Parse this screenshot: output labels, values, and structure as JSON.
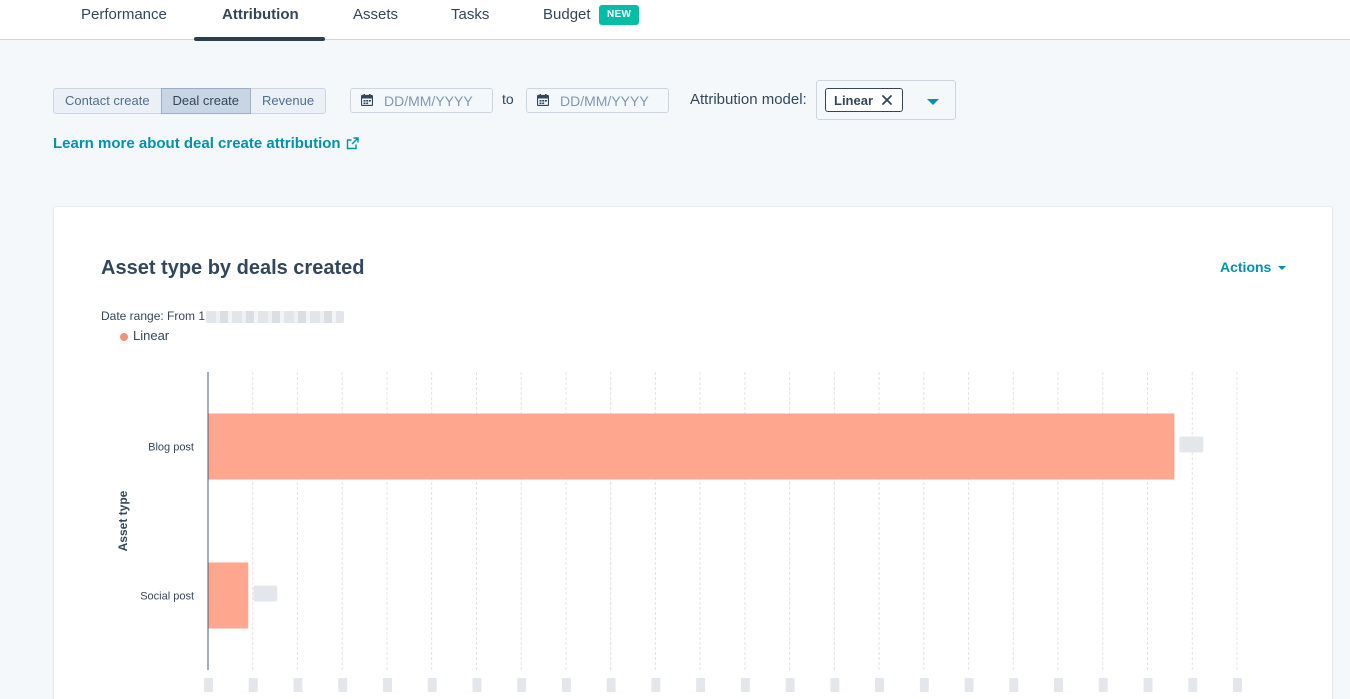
{
  "nav": {
    "tabs": [
      {
        "label": "Performance"
      },
      {
        "label": "Attribution"
      },
      {
        "label": "Assets"
      },
      {
        "label": "Tasks"
      },
      {
        "label": "Budget"
      }
    ],
    "active_tab": "Attribution",
    "budget_badge": "NEW"
  },
  "filters": {
    "segments": [
      "Contact create",
      "Deal create",
      "Revenue"
    ],
    "selected_segment": "Deal create",
    "date_from_placeholder": "DD/MM/YYYY",
    "date_to_placeholder": "DD/MM/YYYY",
    "to_label": "to",
    "model_label": "Attribution model:",
    "model_value": "Linear"
  },
  "learn_more_link": "Learn more about deal create attribution",
  "colors": {
    "accent": "#0091ae",
    "badge": "#00bda5",
    "bar": "#ffa68f",
    "legend_dot": "#f2927c"
  },
  "report": {
    "title": "Asset type by deals created",
    "actions_label": "Actions",
    "date_range_label": "Date range: From 1",
    "legend_label": "Linear"
  },
  "chart_data": {
    "type": "bar",
    "orientation": "horizontal",
    "ylabel": "Asset type",
    "categories": [
      "Blog post",
      "Social post"
    ],
    "series": [
      {
        "name": "Linear",
        "values": [
          21.6,
          0.9
        ]
      }
    ],
    "xlim": [
      0,
      23
    ],
    "grid": "vertical dashed",
    "value_labels_obscured": true,
    "x_tick_labels_obscured": true
  }
}
